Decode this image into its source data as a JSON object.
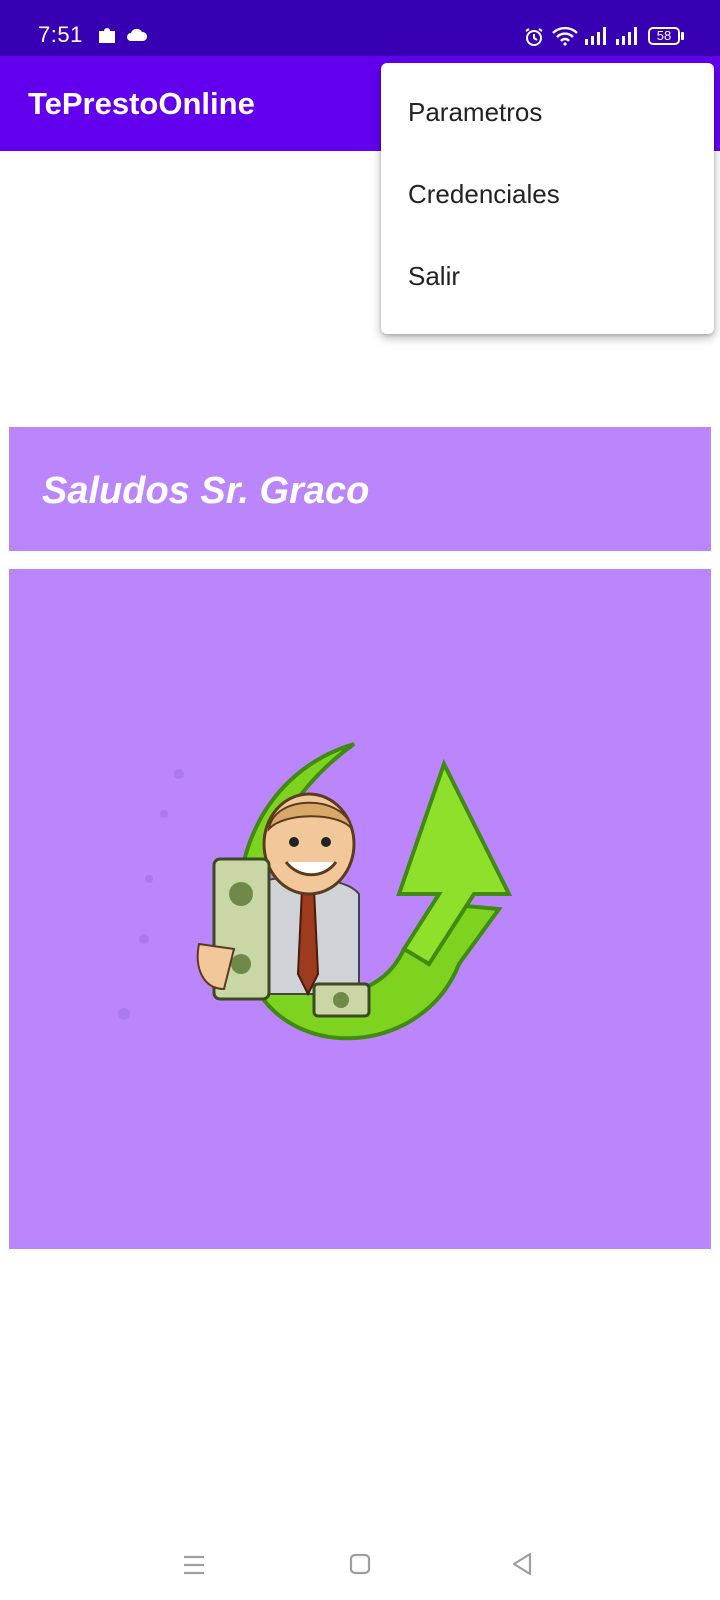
{
  "status_bar": {
    "time": "7:51",
    "battery": "58",
    "icons": [
      "puzzle-icon",
      "cloud-icon",
      "alarm-icon",
      "wifi-icon",
      "signal-icon",
      "signal-icon",
      "battery-icon"
    ]
  },
  "app_bar": {
    "title": "TePrestoOnline"
  },
  "overflow_menu": {
    "items": [
      {
        "label": "Parametros"
      },
      {
        "label": "Credenciales"
      },
      {
        "label": "Salir"
      }
    ]
  },
  "greeting": {
    "text": "Saludos Sr. Graco"
  },
  "logo": {
    "icon": "man-with-money-arrow-logo"
  },
  "nav_bar": {
    "icons": [
      "menu-icon",
      "home-icon",
      "back-icon"
    ]
  },
  "colors": {
    "status_bar": "#3700b3",
    "app_bar": "#6200ee",
    "panel": "#bb86fc",
    "menu_bg": "#ffffff",
    "menu_text": "#222222",
    "arrow_green": "#7ed321"
  }
}
